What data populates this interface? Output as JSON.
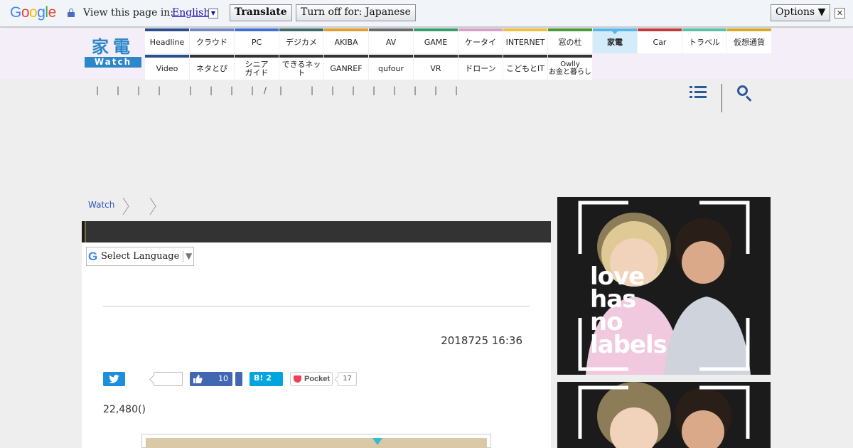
{
  "translate_bar": {
    "logo_letters": [
      {
        "ch": "G",
        "color": "#4285f4"
      },
      {
        "ch": "o",
        "color": "#ea4335"
      },
      {
        "ch": "o",
        "color": "#fbbc05"
      },
      {
        "ch": "g",
        "color": "#4285f4"
      },
      {
        "ch": "l",
        "color": "#34a853"
      },
      {
        "ch": "e",
        "color": "#ea4335"
      }
    ],
    "prompt": "View this page in:",
    "language": "English",
    "translate_button": "Translate",
    "turn_off_button": "Turn off for: Japanese",
    "options_button": "Options ▼",
    "close_glyph": "✕"
  },
  "site": {
    "logo_kanji": "家電",
    "logo_sub": "Watch",
    "nav_row1": [
      {
        "label": "Headline",
        "color": "#2a4e8c"
      },
      {
        "label": "クラウド",
        "color": "#6f87bf"
      },
      {
        "label": "PC",
        "color": "#3d6fd4"
      },
      {
        "label": "デジカメ",
        "color": "#3f6a6a"
      },
      {
        "label": "AKIBA",
        "color": "#e0a030"
      },
      {
        "label": "AV",
        "color": "#6a6a6a"
      },
      {
        "label": "GAME",
        "color": "#33a06a"
      },
      {
        "label": "ケータイ",
        "color": "#d8a0c8"
      },
      {
        "label": "INTERNET",
        "color": "#e8c240"
      },
      {
        "label": "窓の杜",
        "color": "#4a9a3a"
      },
      {
        "label": "家電",
        "color": "#55b8e8",
        "active": true
      },
      {
        "label": "Car",
        "color": "#c23a3a"
      },
      {
        "label": "トラベル",
        "color": "#5ac0a8"
      },
      {
        "label": "仮想通貨",
        "color": "#d8a828"
      }
    ],
    "nav_row2": [
      {
        "label": "Video",
        "color": "#2a4e8c"
      },
      {
        "label": "ネタとぴ",
        "color": "#333333"
      },
      {
        "label": "シニア\nガイド",
        "color": "#333333"
      },
      {
        "label": "できるネット",
        "color": "#333333"
      },
      {
        "label": "GANREF",
        "color": "#333333"
      },
      {
        "label": "qufour",
        "color": "#333333"
      },
      {
        "label": "VR",
        "color": "#333333"
      },
      {
        "label": "ドローン",
        "color": "#333333"
      },
      {
        "label": "こどもとIT",
        "color": "#333333"
      },
      {
        "label": "Owlly\nお金と暮らし",
        "color": "#333333"
      }
    ],
    "utility_separators": [
      "|",
      "|",
      "|",
      "|",
      "|",
      "|",
      "|",
      "|",
      "/",
      "|",
      "|",
      "|",
      "|",
      "|",
      "|",
      "|",
      "|",
      "|"
    ]
  },
  "icons": {
    "menu": "list-menu-icon",
    "search": "search-icon"
  },
  "breadcrumb": {
    "items": [
      "Watch",
      "",
      ""
    ]
  },
  "article": {
    "title": "",
    "select_language": "Select Language",
    "date": "2018725 16:36",
    "share": {
      "facebook_count": "10",
      "hatena_label": "B! 2",
      "pocket_label": "Pocket",
      "pocket_count": "17"
    },
    "price": "22,480()"
  },
  "ads": {
    "text_lines": [
      "love",
      "has",
      "no",
      "labels"
    ]
  }
}
